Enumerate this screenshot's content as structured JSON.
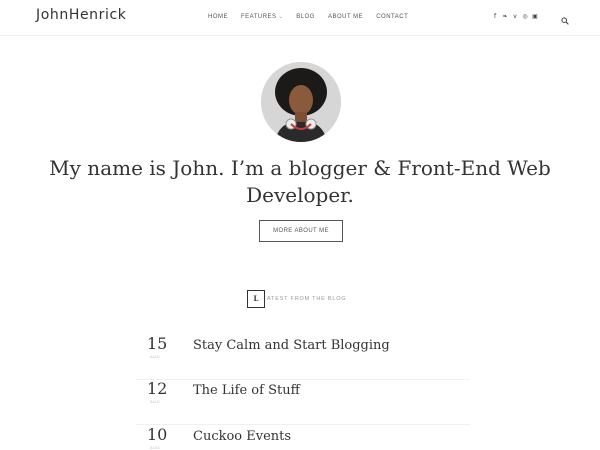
{
  "header": {
    "logo": "JohnHenrick",
    "nav": [
      {
        "label": "Home"
      },
      {
        "label": "Features",
        "has_dropdown": true
      },
      {
        "label": "Blog"
      },
      {
        "label": "About Me"
      },
      {
        "label": "Contact"
      }
    ],
    "dropdown_caret": "⌄",
    "social": [
      {
        "icon": "facebook-icon",
        "glyph": "f"
      },
      {
        "icon": "twitter-icon",
        "glyph": "❧"
      },
      {
        "icon": "vimeo-icon",
        "glyph": "v"
      },
      {
        "icon": "dribbble-icon",
        "glyph": "◎"
      },
      {
        "icon": "instagram-icon",
        "glyph": "▣"
      }
    ]
  },
  "hero": {
    "title": "My name is John. I’m a blogger & Front-End Web Developer.",
    "button_label": "More About Me"
  },
  "section": {
    "letter": "L",
    "rest": "atest from the blog"
  },
  "posts": [
    {
      "day": "15",
      "month": "Aug",
      "title": "Stay Calm and Start Blogging"
    },
    {
      "day": "12",
      "month": "Aug",
      "title": "The Life of Stuff"
    },
    {
      "day": "10",
      "month": "Aug",
      "title": "Cuckoo Events"
    }
  ]
}
